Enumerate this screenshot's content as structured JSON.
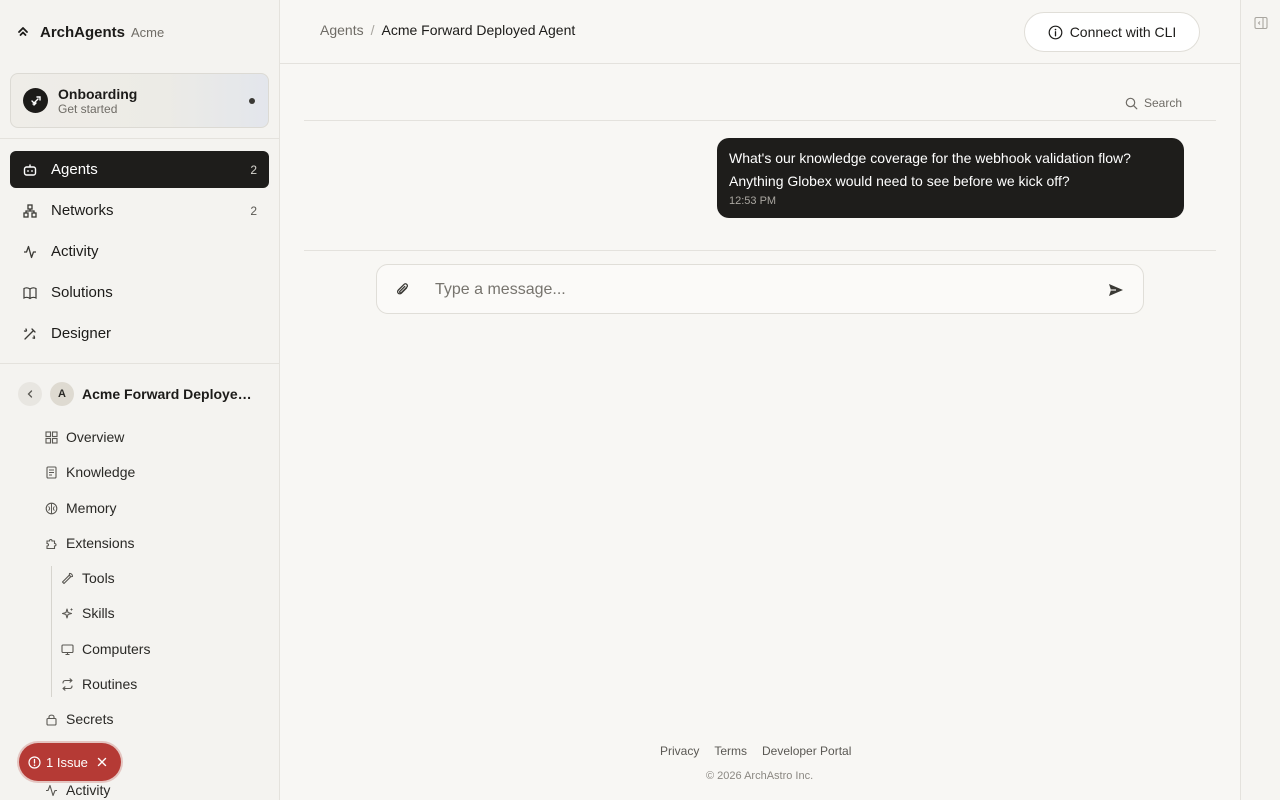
{
  "brand": {
    "name": "ArchAgents",
    "org": "Acme"
  },
  "onboarding": {
    "title": "Onboarding",
    "subtitle": "Get started"
  },
  "nav": [
    {
      "label": "Agents",
      "count": "2",
      "icon": "robot-icon"
    },
    {
      "label": "Networks",
      "count": "2",
      "icon": "network-icon"
    },
    {
      "label": "Activity",
      "count": "",
      "icon": "activity-icon"
    },
    {
      "label": "Solutions",
      "count": "",
      "icon": "book-icon"
    },
    {
      "label": "Designer",
      "count": "",
      "icon": "wand-icon"
    }
  ],
  "agent": {
    "avatar": "A",
    "name": "Acme Forward Deployed Agent",
    "items": [
      {
        "label": "Overview"
      },
      {
        "label": "Knowledge"
      },
      {
        "label": "Memory"
      },
      {
        "label": "Extensions"
      },
      {
        "label": "Tools"
      },
      {
        "label": "Skills"
      },
      {
        "label": "Computers"
      },
      {
        "label": "Routines"
      },
      {
        "label": "Secrets"
      },
      {
        "label": "Activity"
      }
    ]
  },
  "issue": {
    "label": "1 Issue"
  },
  "breadcrumb": {
    "parent": "Agents",
    "separator": "/",
    "current": "Acme Forward Deployed Agent"
  },
  "cli_button": {
    "label": "Connect with CLI"
  },
  "search": {
    "label": "Search"
  },
  "message": {
    "text": "What's our knowledge coverage for the webhook validation flow? Anything Globex would need to see before we kick off?",
    "time": "12:53 PM"
  },
  "composer": {
    "placeholder": "Type a message..."
  },
  "footer": {
    "links": [
      "Privacy",
      "Terms",
      "Developer Portal"
    ],
    "copyright": "© 2026 ArchAstro Inc."
  },
  "colors": {
    "active_nav": "#1e1d1b",
    "issue": "#b53a35",
    "bubble": "#1e1d1b"
  }
}
